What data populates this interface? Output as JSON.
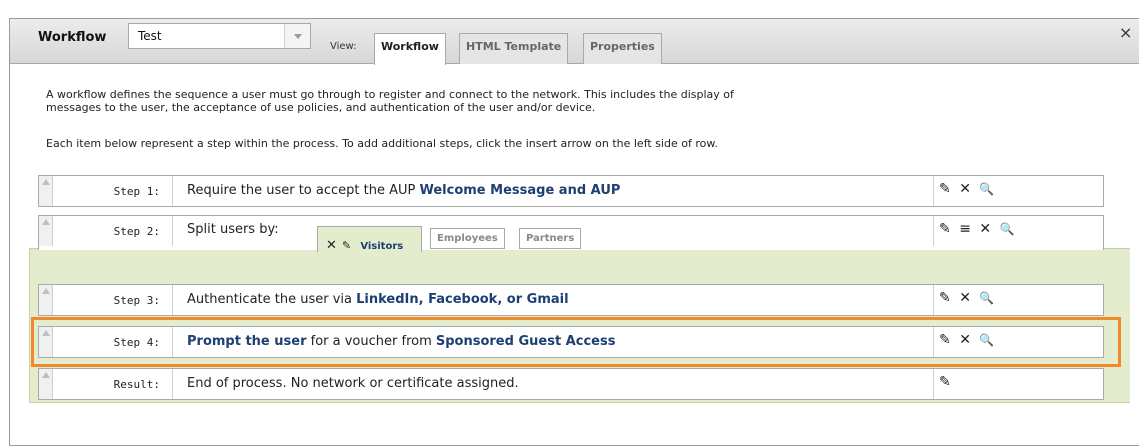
{
  "header": {
    "title": "Workflow",
    "workflow_select_value": "Test",
    "view_label": "View:",
    "tabs": [
      {
        "label": "Workflow",
        "active": true
      },
      {
        "label": "HTML Template",
        "active": false
      },
      {
        "label": "Properties",
        "active": false
      }
    ],
    "close_glyph": "×"
  },
  "description": {
    "para1_line1": "A workflow defines the sequence a user must go through to register and connect to the network. This includes the display of",
    "para1_line2": "messages to the user, the acceptance of use policies, and authentication of the user and/or device.",
    "para2": "Each item below represent a step within the process. To add additional steps, click the insert arrow on the left side of row."
  },
  "steps": [
    {
      "label": "Step 1:",
      "text": "Require the user to accept the AUP ",
      "bold": "Welcome Message and AUP"
    },
    {
      "label": "Step 2:",
      "text": "Split users by:",
      "split_tabs": [
        "Visitors",
        "Employees",
        "Partners"
      ]
    },
    {
      "label": "Step 3:",
      "text": "Authenticate the user via ",
      "bold": "LinkedIn, Facebook, or Gmail"
    },
    {
      "label": "Step 4:",
      "bold_prefix": "Prompt the user",
      "text": " for a voucher from ",
      "bold": "Sponsored Guest Access"
    },
    {
      "label": "Result:",
      "text": "End of process. No network or certificate assigned."
    }
  ],
  "icons": {
    "edit": "✎",
    "delete": "✕",
    "search": "🔍",
    "list": "≡"
  },
  "colors": {
    "accent_highlight": "#f0892b",
    "branch_panel": "#e4ecce",
    "link_bold": "#1d3f72"
  }
}
